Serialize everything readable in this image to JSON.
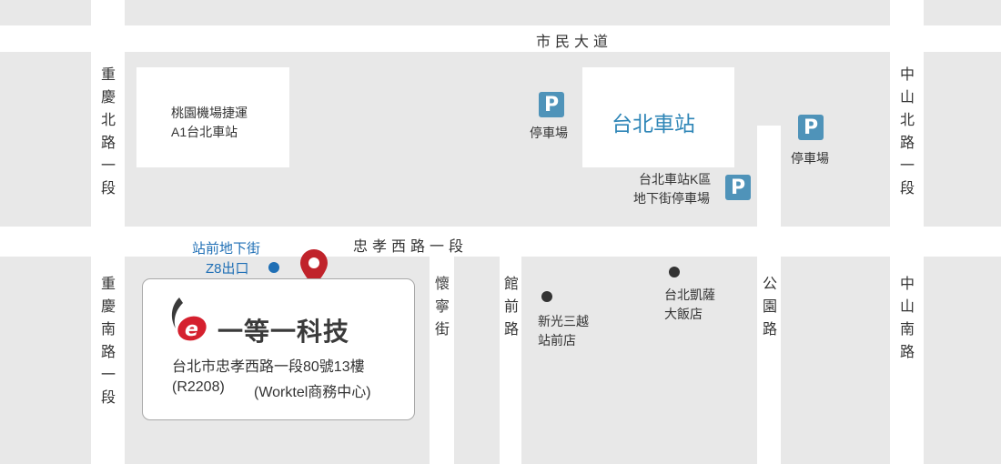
{
  "roads": {
    "shimin": "市民大道",
    "zhongxiao": "忠孝西路一段",
    "chongqing_north": "重慶北路一段",
    "chongqing_south": "重慶南路一段",
    "zhongshan_north": "中山北路一段",
    "zhongshan_south": "中山南路",
    "huaining": "懷寧街",
    "guanqian": "館前路",
    "gongyuan": "公園路"
  },
  "landmarks": {
    "airport_mrt": [
      "桃園機場捷運",
      "A1台北車站"
    ],
    "taipei_station": "台北車站",
    "parking_label": "停車場",
    "k_area": [
      "台北車站K區",
      "地下街停車場"
    ],
    "underground_exit": [
      "站前地下街",
      "Z8出口"
    ],
    "mitsukoshi": [
      "新光三越",
      "站前店"
    ],
    "sheraton": [
      "台北凱薩",
      "大飯店"
    ]
  },
  "company": {
    "logo_glyph": "e",
    "name": "一等一科技",
    "address": "台北市忠孝西路一段80號13樓",
    "room": "(R2208)",
    "center": "(Worktel商務中心)"
  },
  "icons": {
    "parking": "P",
    "location_pin": "map-pin-icon",
    "exit_marker": "exit-dot-icon"
  },
  "colors": {
    "block": "#e8e8e8",
    "parking": "#4f93b9",
    "accent_blue": "#1f6fb5",
    "station_text": "#2f86b7",
    "pin": "#c0232b",
    "logo_red": "#d5202e",
    "logo_dark": "#3a3a3a"
  }
}
